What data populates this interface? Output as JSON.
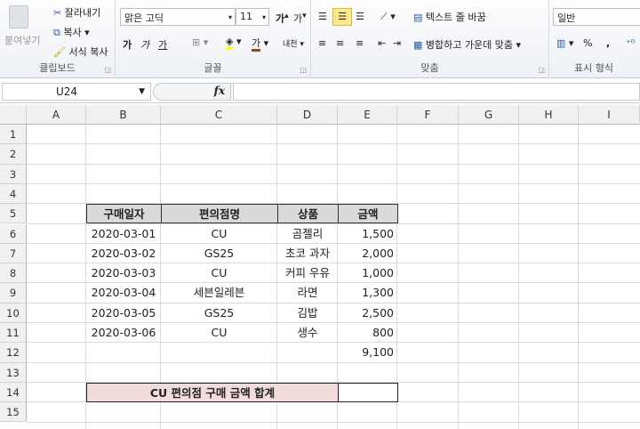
{
  "ribbon": {
    "clipboard": {
      "paste": "붙여넣기",
      "cut": "잘라내기",
      "copy": "복사",
      "format_painter": "서식 복사",
      "label": "클립보드"
    },
    "font": {
      "name": "맑은 고딕",
      "size": "11",
      "bold": "가",
      "italic": "가",
      "underline": "가",
      "font_color": "가",
      "phonetic": "내천",
      "label": "글꼴"
    },
    "alignment": {
      "wrap_text": "텍스트 줄 바꿈",
      "merge_center": "병합하고 가운데 맞춤",
      "label": "맞춤"
    },
    "number": {
      "format": "일반",
      "percent": "%",
      "comma": ",",
      "label": "표시 형식"
    }
  },
  "formula_bar": {
    "name_box": "U24",
    "fx": "fx",
    "value": ""
  },
  "columns": [
    "A",
    "B",
    "C",
    "D",
    "E",
    "F",
    "G",
    "H",
    "I"
  ],
  "rows": [
    "1",
    "2",
    "3",
    "4",
    "5",
    "6",
    "7",
    "8",
    "9",
    "10",
    "11",
    "12",
    "13",
    "14",
    "15"
  ],
  "table": {
    "headers": [
      "구매일자",
      "편의점명",
      "상품",
      "금액"
    ],
    "rows": [
      [
        "2020-03-01",
        "CU",
        "곰젤리",
        "1,500"
      ],
      [
        "2020-03-02",
        "GS25",
        "초코 과자",
        "2,000"
      ],
      [
        "2020-03-03",
        "CU",
        "커피 우유",
        "1,000"
      ],
      [
        "2020-03-04",
        "세븐일레븐",
        "라면",
        "1,300"
      ],
      [
        "2020-03-05",
        "GS25",
        "김밥",
        "2,500"
      ],
      [
        "2020-03-06",
        "CU",
        "생수",
        "800"
      ]
    ],
    "total": "9,100",
    "summary_label": "CU 편의점 구매 금액 합계",
    "summary_value": ""
  },
  "colors": {
    "header_fill": "#d9d9d9",
    "summary_fill": "#f2dcdb"
  }
}
